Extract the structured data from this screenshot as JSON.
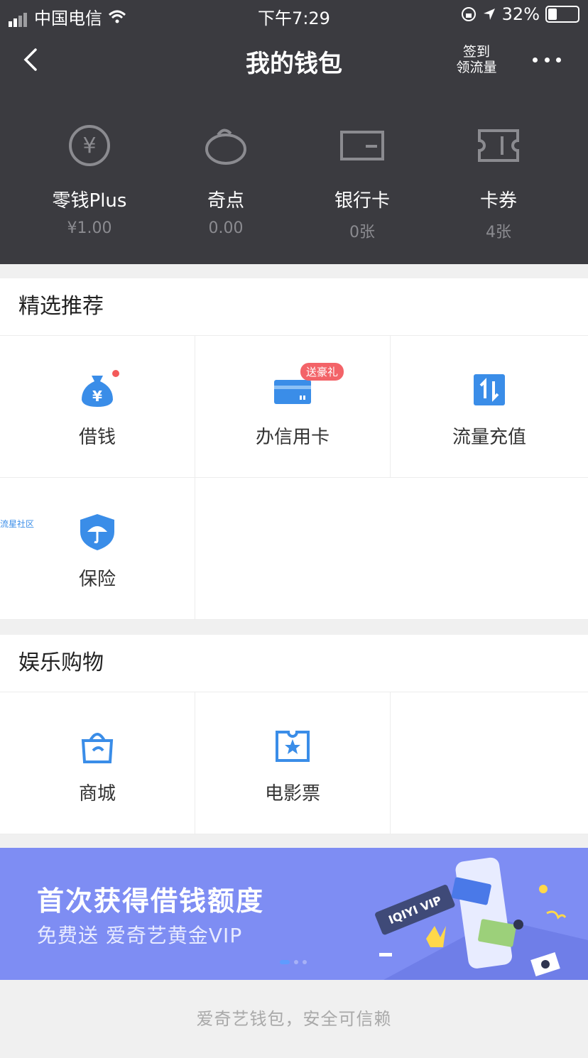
{
  "status_bar": {
    "carrier": "中国电信",
    "time": "下午7:29",
    "battery": "32%"
  },
  "nav": {
    "title": "我的钱包",
    "sign_line1": "签到",
    "sign_line2": "领流量"
  },
  "quick": [
    {
      "label": "零钱Plus",
      "value": "¥1.00",
      "icon": "yuan-circle-icon"
    },
    {
      "label": "奇点",
      "value": "0.00",
      "icon": "qidian-icon"
    },
    {
      "label": "银行卡",
      "value": "0张",
      "icon": "bank-card-icon"
    },
    {
      "label": "卡券",
      "value": "4张",
      "icon": "ticket-icon"
    }
  ],
  "featured": {
    "title": "精选推荐",
    "items": [
      {
        "label": "借钱",
        "icon": "money-bag-icon"
      },
      {
        "label": "办信用卡",
        "icon": "credit-card-icon",
        "badge": "送豪礼"
      },
      {
        "label": "流量充值",
        "icon": "data-topup-icon"
      },
      {
        "label": "保险",
        "icon": "insurance-shield-icon"
      }
    ],
    "watermark": "流星社区"
  },
  "entertainment": {
    "title": "娱乐购物",
    "items": [
      {
        "label": "商城",
        "icon": "shopping-bag-icon"
      },
      {
        "label": "电影票",
        "icon": "movie-ticket-icon"
      }
    ]
  },
  "banner": {
    "headline": "首次获得借钱额度",
    "subline": "免费送 爱奇艺黄金VIP",
    "art_text": "IQIYI VIP",
    "pages": 3,
    "active_page": 1
  },
  "footer": {
    "text": "爱奇艺钱包，安全可信赖"
  },
  "colors": {
    "header_bg": "#3b3b40",
    "accent_blue": "#3a8de8",
    "banner_bg": "#7e8df3",
    "badge_red": "#f36368"
  }
}
